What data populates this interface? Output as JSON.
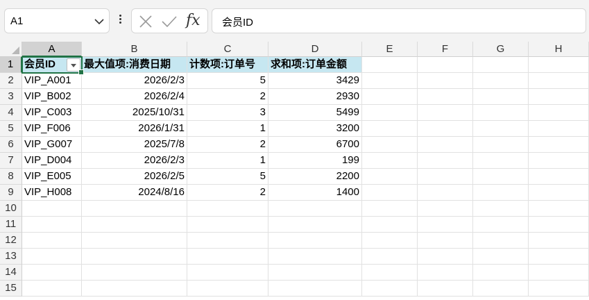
{
  "formula_bar": {
    "name_box": "A1",
    "formula": "会员ID",
    "fx_label": "fx"
  },
  "columns": [
    "A",
    "B",
    "C",
    "D",
    "E",
    "F",
    "G",
    "H"
  ],
  "rows": [
    "1",
    "2",
    "3",
    "4",
    "5",
    "6",
    "7",
    "8",
    "9",
    "10",
    "11",
    "12",
    "13",
    "14",
    "15"
  ],
  "table": {
    "headers": [
      "会员ID",
      "最大值项:消费日期",
      "计数项:订单号",
      "求和项:订单金额"
    ],
    "records": [
      [
        "VIP_A001",
        "2026/2/3",
        "5",
        "3429"
      ],
      [
        "VIP_B002",
        "2026/2/4",
        "2",
        "2930"
      ],
      [
        "VIP_C003",
        "2025/10/31",
        "3",
        "5499"
      ],
      [
        "VIP_F006",
        "2026/1/31",
        "1",
        "3200"
      ],
      [
        "VIP_G007",
        "2025/7/8",
        "2",
        "6700"
      ],
      [
        "VIP_D004",
        "2026/2/3",
        "1",
        "199"
      ],
      [
        "VIP_E005",
        "2026/2/5",
        "5",
        "2200"
      ],
      [
        "VIP_H008",
        "2024/8/16",
        "2",
        "1400"
      ]
    ]
  },
  "colors": {
    "accent": "#217346",
    "header_fill": "#c6e7f1"
  }
}
